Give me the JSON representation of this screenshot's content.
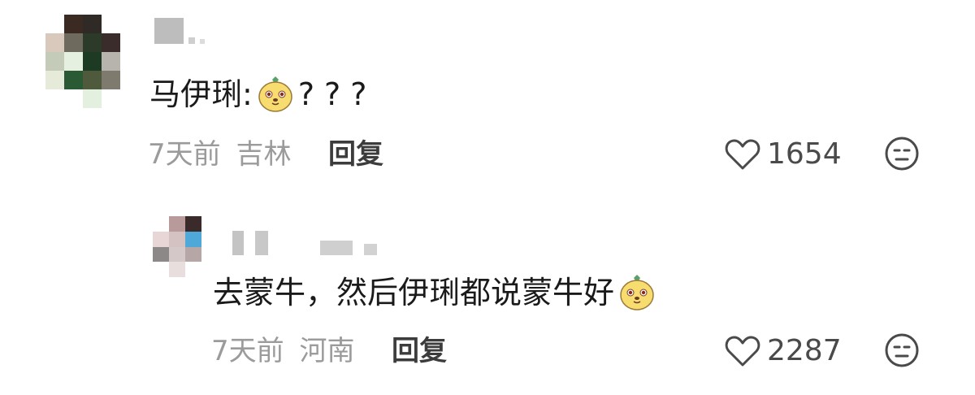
{
  "comments": [
    {
      "text_main": "马伊琍:",
      "emoji": "yellow-dog-emoji",
      "text_after": "? ? ?",
      "time": "7天前",
      "location": "吉林",
      "reply_label": "回复",
      "likes": "1654"
    },
    {
      "text_main": "去蒙牛，然后伊琍都说蒙牛好",
      "emoji": "yellow-dog-emoji",
      "text_after": "",
      "time": "7天前",
      "location": "河南",
      "reply_label": "回复",
      "likes": "2287"
    }
  ],
  "icons": {
    "like": "heart-outline-icon",
    "more": "meh-face-icon"
  },
  "colors": {
    "text": "#1a1a1a",
    "meta": "#9b9b9b",
    "icon": "#4a4a4a",
    "emoji_body": "#f7dc6f"
  }
}
